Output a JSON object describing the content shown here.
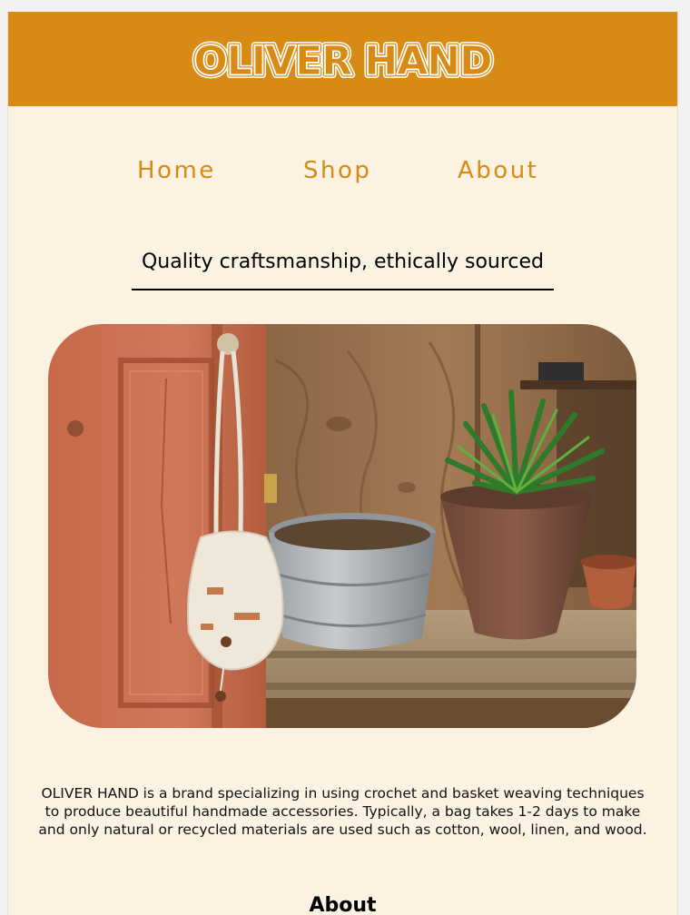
{
  "header": {
    "logo_text": "OLIVER HAND",
    "background_color": "#d78a14"
  },
  "nav": {
    "items": [
      {
        "label": "Home"
      },
      {
        "label": "Shop"
      },
      {
        "label": "About"
      }
    ],
    "link_color": "#d78a14"
  },
  "tagline": "Quality craftsmanship, ethically sourced",
  "hero": {
    "description_of_image": "photo"
  },
  "description": "OLIVER HAND is a brand specializing in using crochet and basket weaving techniques to produce beautiful handmade accessories. Typically, a bag takes 1-2 days to make and only natural or recycled materials are used such as cotton, wool, linen, and wood.",
  "sections": {
    "about_heading": "About"
  },
  "colors": {
    "page_background": "#fbf2e1",
    "accent": "#d78a14"
  }
}
